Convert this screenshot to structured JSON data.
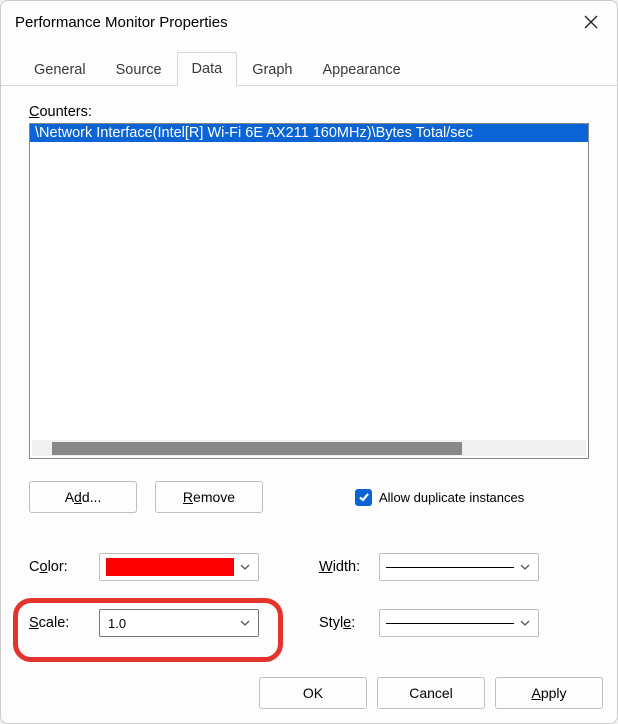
{
  "titlebar": {
    "title": "Performance Monitor Properties"
  },
  "tabs": {
    "items": [
      {
        "label": "General"
      },
      {
        "label": "Source"
      },
      {
        "label": "Data"
      },
      {
        "label": "Graph"
      },
      {
        "label": "Appearance"
      }
    ],
    "active_index": 2
  },
  "counters": {
    "label": "Counters:",
    "items": [
      "\\Network Interface(Intel[R] Wi-Fi 6E AX211 160MHz)\\Bytes Total/sec"
    ]
  },
  "buttons": {
    "add": "Add...",
    "remove": "Remove",
    "ok": "OK",
    "cancel": "Cancel",
    "apply": "Apply"
  },
  "checkbox": {
    "allow_dup": {
      "label": "Allow duplicate instances",
      "checked": true
    }
  },
  "fields": {
    "color": {
      "label": "Color:",
      "value": "#ff0000"
    },
    "width": {
      "label": "Width:",
      "value": "1"
    },
    "scale": {
      "label": "Scale:",
      "value": "1.0"
    },
    "style": {
      "label": "Style:",
      "value": "solid"
    }
  }
}
